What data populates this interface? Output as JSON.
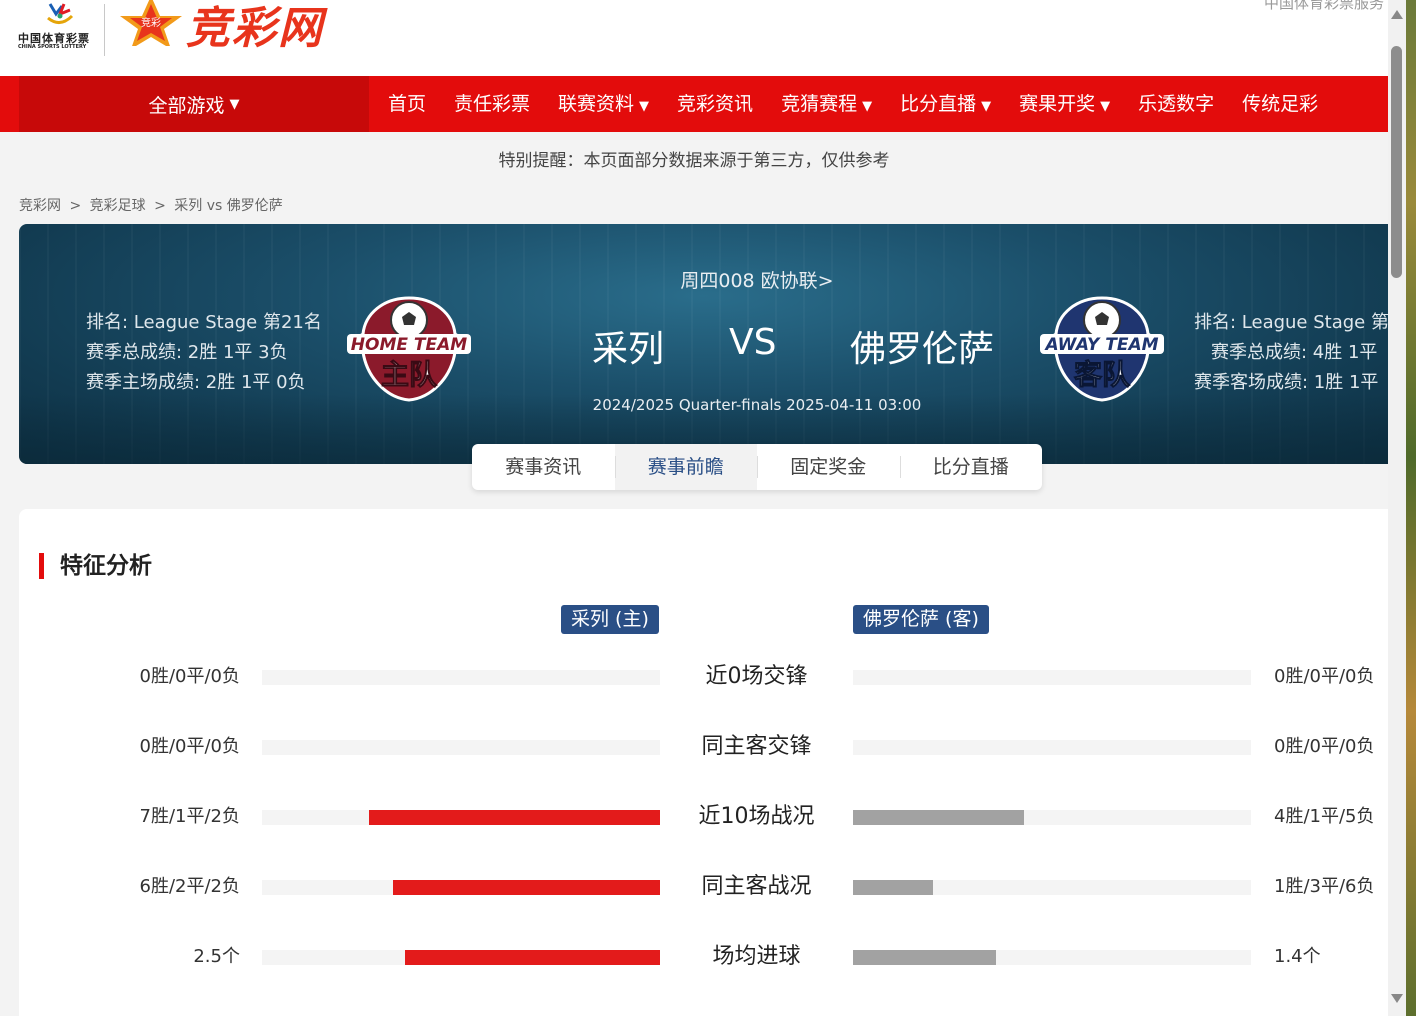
{
  "header": {
    "logo_cn_line1": "中国体育彩票",
    "logo_cn_line2": "CHINA SPORTS LOTTERY",
    "logo_jc_badge": "竞彩",
    "logo_jc_text": "竞彩网",
    "top_right_text": "中国体育彩票服务"
  },
  "nav": {
    "all_games": "全部游戏",
    "items": [
      {
        "label": "首页",
        "dropdown": false
      },
      {
        "label": "责任彩票",
        "dropdown": false
      },
      {
        "label": "联赛资料",
        "dropdown": true
      },
      {
        "label": "竞彩资讯",
        "dropdown": false
      },
      {
        "label": "竞猜赛程",
        "dropdown": true
      },
      {
        "label": "比分直播",
        "dropdown": true
      },
      {
        "label": "赛果开奖",
        "dropdown": true
      },
      {
        "label": "乐透数字",
        "dropdown": false
      },
      {
        "label": "传统足彩",
        "dropdown": false
      }
    ],
    "dropdown_glyph": "▼"
  },
  "notice": "特别提醒：本页面部分数据来源于第三方，仅供参考",
  "breadcrumb": [
    "竞彩网",
    "竞彩足球",
    "采列 vs 佛罗伦萨"
  ],
  "breadcrumb_sep": ">",
  "match": {
    "league_line": "周四008 欧协联>",
    "home_team": "采列",
    "away_team": "佛罗伦萨",
    "vs": "VS",
    "info": "2024/2025 Quarter-finals 2025-04-11 03:00",
    "home_badge_top": "HOME TEAM",
    "home_badge_main": "主队",
    "away_badge_top": "AWAY TEAM",
    "away_badge_main": "客队",
    "home_stats": {
      "rank": "排名: League Stage 第21名",
      "season": "赛季总成绩: 2胜 1平 3负",
      "venue": "赛季主场成绩: 2胜 1平 0负"
    },
    "away_stats": {
      "rank": "排名: League Stage 第",
      "season": "赛季总成绩: 4胜 1平",
      "venue": "赛季客场成绩: 1胜 1平"
    }
  },
  "tabs": [
    {
      "label": "赛事资讯",
      "active": false
    },
    {
      "label": "赛事前瞻",
      "active": true
    },
    {
      "label": "固定奖金",
      "active": false
    },
    {
      "label": "比分直播",
      "active": false
    }
  ],
  "analysis": {
    "title": "特征分析",
    "home_tag": "采列 (主)",
    "away_tag": "佛罗伦萨 (客)",
    "colors": {
      "home_bar": "#e31b1b",
      "away_bar": "#a2a2a2",
      "tag": "#2a4f86"
    },
    "rows": [
      {
        "label": "近0场交锋",
        "home_value": "0胜/0平/0负",
        "home_fraction": 0,
        "away_value": "0胜/0平/0负",
        "away_fraction": 0
      },
      {
        "label": "同主客交锋",
        "home_value": "0胜/0平/0负",
        "home_fraction": 0,
        "away_value": "0胜/0平/0负",
        "away_fraction": 0
      },
      {
        "label": "近10场战况",
        "home_value": "7胜/1平/2负",
        "home_fraction": 0.73,
        "away_value": "4胜/1平/5负",
        "away_fraction": 0.43
      },
      {
        "label": "同主客战况",
        "home_value": "6胜/2平/2负",
        "home_fraction": 0.67,
        "away_value": "1胜/3平/6负",
        "away_fraction": 0.2
      },
      {
        "label": "场均进球",
        "home_value": "2.5个",
        "home_fraction": 0.64,
        "away_value": "1.4个",
        "away_fraction": 0.36
      }
    ]
  }
}
